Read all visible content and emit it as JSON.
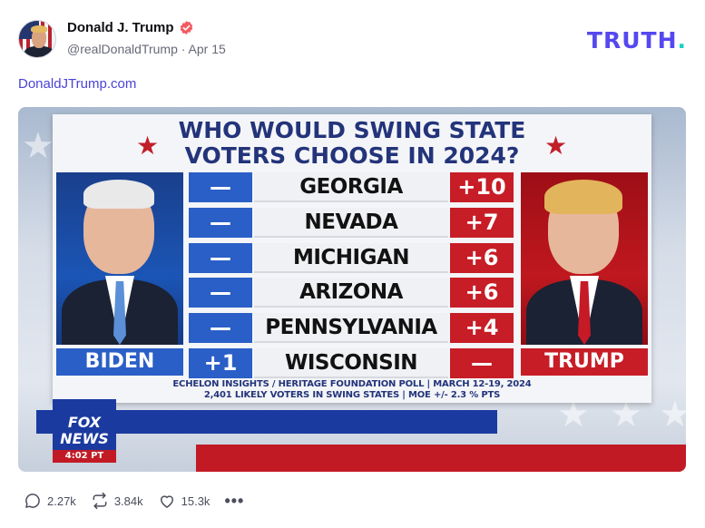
{
  "post": {
    "author_name": "Donald J. Trump",
    "handle": "@realDonaldTrump",
    "separator": "·",
    "date": "Apr 15",
    "link_text": "DonaldJTrump.com"
  },
  "brand": {
    "logo_text": "TRUTH",
    "logo_dot": ".",
    "logo_color": "#5448ee",
    "dot_color": "#18d1c4"
  },
  "media": {
    "title_line1": "WHO WOULD SWING STATE",
    "title_line2": "VOTERS CHOOSE IN 2024?",
    "candidate_left": "BIDEN",
    "candidate_right": "TRUMP",
    "rows": [
      {
        "state": "GEORGIA",
        "biden": "—",
        "trump": "+10"
      },
      {
        "state": "NEVADA",
        "biden": "—",
        "trump": "+7"
      },
      {
        "state": "MICHIGAN",
        "biden": "—",
        "trump": "+6"
      },
      {
        "state": "ARIZONA",
        "biden": "—",
        "trump": "+6"
      },
      {
        "state": "PENNSYLVANIA",
        "biden": "—",
        "trump": "+4"
      },
      {
        "state": "WISCONSIN",
        "biden": "+1",
        "trump": "—"
      }
    ],
    "source_line1": "ECHELON INSIGHTS / HERITAGE FOUNDATION POLL | MARCH 12-19, 2024",
    "source_line2": "2,401 LIKELY VOTERS IN SWING STATES | MOE +/- 2.3 % PTS",
    "network_line1": "FOX",
    "network_line2": "NEWS",
    "time": "4:02 PT",
    "colors": {
      "biden_blue": "#2a5fc7",
      "trump_red": "#c71d27",
      "title_navy": "#23347a"
    }
  },
  "actions": {
    "replies": "2.27k",
    "retruths": "3.84k",
    "likes": "15.3k",
    "more": "•••"
  }
}
